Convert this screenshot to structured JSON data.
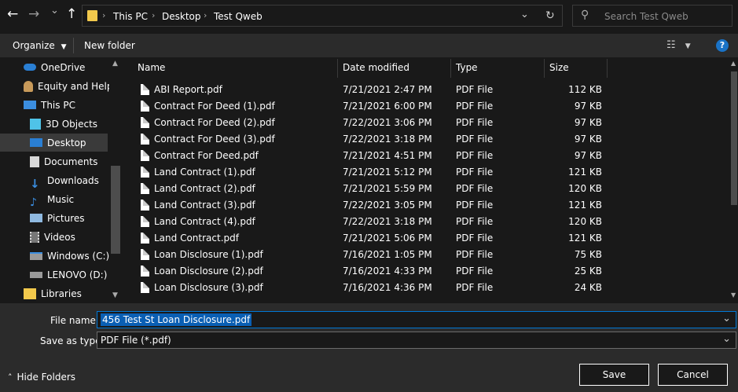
{
  "nav": {
    "back": "←",
    "forward": "→",
    "recent": "⌄",
    "up": "↑"
  },
  "address": {
    "crumbs": [
      "This PC",
      "Desktop",
      "Test Qweb"
    ]
  },
  "search": {
    "placeholder": "Search Test Qweb"
  },
  "toolbar": {
    "organize_label": "Organize",
    "new_folder_label": "New folder"
  },
  "sidebar": {
    "items": [
      {
        "label": "OneDrive"
      },
      {
        "label": "Equity and Help"
      },
      {
        "label": "This PC"
      },
      {
        "label": "3D Objects"
      },
      {
        "label": "Desktop"
      },
      {
        "label": "Documents"
      },
      {
        "label": "Downloads"
      },
      {
        "label": "Music"
      },
      {
        "label": "Pictures"
      },
      {
        "label": "Videos"
      },
      {
        "label": "Windows (C:)"
      },
      {
        "label": "LENOVO (D:)"
      },
      {
        "label": "Libraries"
      }
    ]
  },
  "columns": {
    "name": "Name",
    "date": "Date modified",
    "type": "Type",
    "size": "Size"
  },
  "files": [
    {
      "name": "ABI Report.pdf",
      "date": "7/21/2021 2:47 PM",
      "type": "PDF File",
      "size": "112 KB"
    },
    {
      "name": "Contract For Deed (1).pdf",
      "date": "7/21/2021 6:00 PM",
      "type": "PDF File",
      "size": "97 KB"
    },
    {
      "name": "Contract For Deed (2).pdf",
      "date": "7/22/2021 3:06 PM",
      "type": "PDF File",
      "size": "97 KB"
    },
    {
      "name": "Contract For Deed (3).pdf",
      "date": "7/22/2021 3:18 PM",
      "type": "PDF File",
      "size": "97 KB"
    },
    {
      "name": "Contract For Deed.pdf",
      "date": "7/21/2021 4:51 PM",
      "type": "PDF File",
      "size": "97 KB"
    },
    {
      "name": "Land Contract (1).pdf",
      "date": "7/21/2021 5:12 PM",
      "type": "PDF File",
      "size": "121 KB"
    },
    {
      "name": "Land Contract (2).pdf",
      "date": "7/21/2021 5:59 PM",
      "type": "PDF File",
      "size": "120 KB"
    },
    {
      "name": "Land Contract (3).pdf",
      "date": "7/22/2021 3:05 PM",
      "type": "PDF File",
      "size": "121 KB"
    },
    {
      "name": "Land Contract (4).pdf",
      "date": "7/22/2021 3:18 PM",
      "type": "PDF File",
      "size": "120 KB"
    },
    {
      "name": "Land Contract.pdf",
      "date": "7/21/2021 5:06 PM",
      "type": "PDF File",
      "size": "121 KB"
    },
    {
      "name": "Loan Disclosure (1).pdf",
      "date": "7/16/2021 1:05 PM",
      "type": "PDF File",
      "size": "75 KB"
    },
    {
      "name": "Loan Disclosure (2).pdf",
      "date": "7/16/2021 4:33 PM",
      "type": "PDF File",
      "size": "25 KB"
    },
    {
      "name": "Loan Disclosure (3).pdf",
      "date": "7/16/2021 4:36 PM",
      "type": "PDF File",
      "size": "24 KB"
    }
  ],
  "form": {
    "filename_label": "File name:",
    "filename_value": "456 Test St Loan Disclosure.pdf",
    "savetype_label": "Save as type:",
    "savetype_value": "PDF File (*.pdf)"
  },
  "footer": {
    "hide_folders_label": "Hide Folders",
    "save_label": "Save",
    "cancel_label": "Cancel"
  },
  "colors": {
    "accent": "#0078d7",
    "help": "#1a73c7",
    "selection": "#0a5fb4",
    "folder": "#f2c94c"
  }
}
